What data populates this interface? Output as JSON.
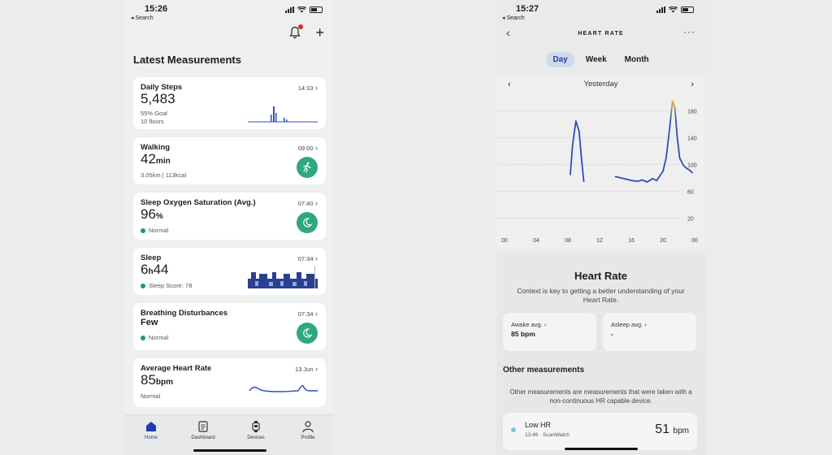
{
  "left": {
    "status": {
      "time": "15:26",
      "back": "◂ Search"
    },
    "section_title": "Latest Measurements",
    "cards": [
      {
        "title": "Daily Steps",
        "meta": "14:33",
        "value": "5,483",
        "unit": "",
        "sub1": "55% Goal",
        "sub2": "10 floors"
      },
      {
        "title": "Walking",
        "meta": "09:00",
        "value": "42",
        "unit": "min",
        "sub1": "3.05km | 113kcal"
      },
      {
        "title": "Sleep Oxygen Saturation (Avg.)",
        "meta": "07:40",
        "value": "96",
        "unit": "%",
        "status": "Normal"
      },
      {
        "title": "Sleep",
        "meta": "07:34",
        "value": "6",
        "unit_mid": "h",
        "value2": "44",
        "status": "Sleep Score: 78"
      },
      {
        "title": "Breathing Disturbances",
        "meta": "07:34",
        "value": "Few",
        "status": "Normal"
      },
      {
        "title": "Average Heart Rate",
        "meta": "13 Jun",
        "value": "85",
        "unit": "bpm",
        "sub1": "Normal"
      }
    ],
    "tabs": [
      {
        "label": "Home",
        "icon": "home-icon"
      },
      {
        "label": "Dashboard",
        "icon": "dashboard-icon"
      },
      {
        "label": "Devices",
        "icon": "watch-icon"
      },
      {
        "label": "Profile",
        "icon": "profile-icon"
      }
    ]
  },
  "right": {
    "status": {
      "time": "15:27",
      "back": "◂ Search"
    },
    "nav_title": "HEART RATE",
    "segments": [
      "Day",
      "Week",
      "Month"
    ],
    "active_segment": "Day",
    "date_label": "Yesterday",
    "info_title": "Heart Rate",
    "info_desc": "Context is key to getting a better understanding of your Heart Rate.",
    "awake_label": "Awake avg.",
    "awake_value": "85 bpm",
    "asleep_label": "Asleep avg.",
    "asleep_value": "-",
    "other_title": "Other measurements",
    "other_desc": "Other measurements are measurements that were taken with a non-continuous HR capable device.",
    "lowhr_name": "Low HR",
    "lowhr_time": "13:46 · ScanWatch",
    "lowhr_value": "51",
    "lowhr_unit": "bpm"
  },
  "colors": {
    "accent": "#1f3fa8",
    "green": "#2fa77f",
    "line": "#2c4fb7",
    "peak": "#e8b933"
  },
  "chart_data": {
    "type": "line",
    "title": "",
    "xlabel": "",
    "ylabel": "",
    "x_ticks": [
      "00",
      "04",
      "08",
      "12",
      "16",
      "20",
      "00"
    ],
    "y_ticks": [
      20,
      60,
      100,
      140,
      180
    ],
    "ylim": [
      0,
      200
    ],
    "xlim": [
      0,
      24
    ],
    "series": [
      {
        "segment": 1,
        "x": [
          8.3,
          8.6,
          9.0,
          9.4,
          9.7,
          10.0
        ],
        "y": [
          85,
          130,
          165,
          150,
          110,
          75
        ]
      },
      {
        "segment": 2,
        "x": [
          14.0,
          14.7,
          15.4,
          16.1,
          16.8,
          17.4,
          18.0,
          18.7,
          19.2,
          19.6,
          20.0,
          20.4,
          20.8,
          21.2,
          21.5,
          21.8,
          22.1,
          22.5,
          22.9,
          23.3,
          23.7
        ],
        "y": [
          82,
          80,
          78,
          76,
          75,
          77,
          74,
          79,
          76,
          83,
          90,
          110,
          150,
          195,
          185,
          140,
          110,
          100,
          95,
          92,
          88
        ]
      }
    ]
  }
}
